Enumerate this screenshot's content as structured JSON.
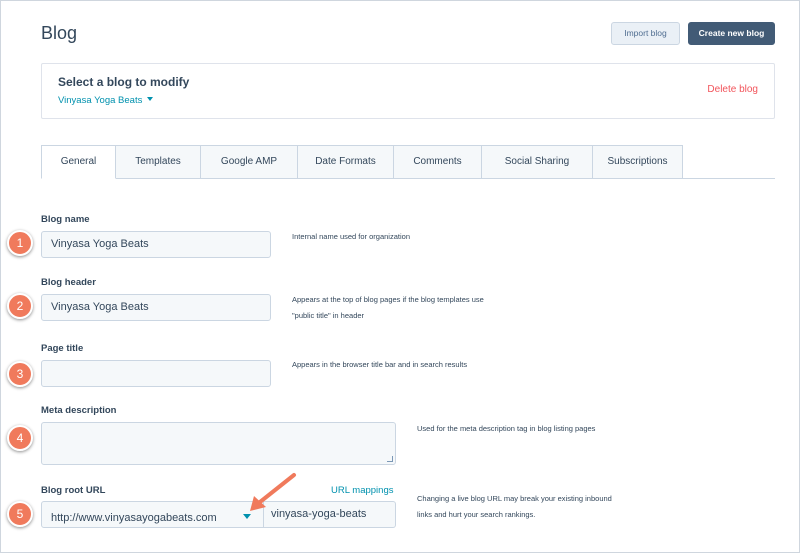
{
  "page": {
    "title": "Blog"
  },
  "header_actions": {
    "import_label": "Import blog",
    "create_label": "Create new blog"
  },
  "selector": {
    "heading": "Select a blog to modify",
    "selected_blog": "Vinyasa Yoga Beats",
    "delete_label": "Delete blog"
  },
  "tabs": [
    {
      "label": "General",
      "active": true
    },
    {
      "label": "Templates"
    },
    {
      "label": "Google AMP"
    },
    {
      "label": "Date Formats"
    },
    {
      "label": "Comments"
    },
    {
      "label": "Social Sharing"
    },
    {
      "label": "Subscriptions"
    }
  ],
  "fields": {
    "blog_name": {
      "label": "Blog name",
      "value": "Vinyasa Yoga Beats",
      "help": "Internal name used for organization"
    },
    "blog_header": {
      "label": "Blog header",
      "value": "Vinyasa Yoga Beats",
      "help_line1": "Appears at the top of blog pages if the blog templates use",
      "help_line2": "\"public title\" in header"
    },
    "page_title": {
      "label": "Page title",
      "value": "",
      "help": "Appears in the browser title bar and in search results"
    },
    "meta_description": {
      "label": "Meta description",
      "value": "",
      "help": "Used for the meta description tag in blog listing pages"
    },
    "root_url": {
      "label": "Blog root URL",
      "mappings_link": "URL mappings",
      "domain": "http://www.vinyasayogabeats.com",
      "slug": "vinyasa-yoga-beats",
      "help_line1": "Changing a live blog URL may break your existing inbound",
      "help_line2": "links and hurt your search rankings."
    }
  },
  "annotations": {
    "markers": [
      "1",
      "2",
      "3",
      "4",
      "5"
    ],
    "color": "#f07a5c"
  },
  "colors": {
    "primary_dark": "#425b76",
    "link": "#0091ae",
    "danger": "#f2545b",
    "text": "#33475b"
  }
}
